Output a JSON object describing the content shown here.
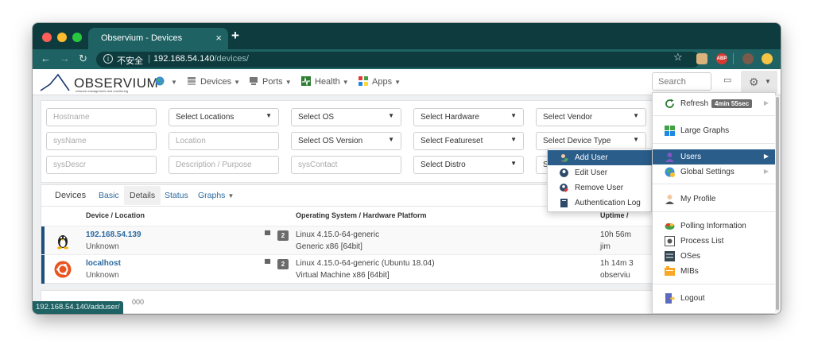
{
  "browser": {
    "tab_title": "Observium - Devices",
    "tab_close": "×",
    "new_tab": "+",
    "insecure_label": "不安全",
    "url_host": "192.168.54.140",
    "url_path": "/devices/",
    "status_url": "192.168.54.140/adduser/"
  },
  "nav": {
    "logo_text": "OBSERVIUM",
    "logo_tagline": "network management and monitoring",
    "items": [
      {
        "label": "Devices"
      },
      {
        "label": "Ports"
      },
      {
        "label": "Health"
      },
      {
        "label": "Apps"
      }
    ],
    "search_placeholder": "Search"
  },
  "filters": {
    "row1": [
      {
        "type": "input",
        "text": "Hostname"
      },
      {
        "type": "select",
        "text": "Select Locations"
      },
      {
        "type": "select",
        "text": "Select OS"
      },
      {
        "type": "select",
        "text": "Select Hardware"
      },
      {
        "type": "select",
        "text": "Select Vendor"
      }
    ],
    "row2": [
      {
        "type": "input",
        "text": "sysName"
      },
      {
        "type": "input",
        "text": "Location"
      },
      {
        "type": "select",
        "text": "Select OS Version"
      },
      {
        "type": "select",
        "text": "Select Featureset"
      },
      {
        "type": "select",
        "text": "Select Device Type"
      }
    ],
    "row3": [
      {
        "type": "input",
        "text": "sysDescr"
      },
      {
        "type": "input",
        "text": "Description / Purpose"
      },
      {
        "type": "input",
        "text": "sysContact"
      },
      {
        "type": "select",
        "text": "Select Distro"
      },
      {
        "type": "select",
        "text": "S"
      }
    ]
  },
  "device_tabs": {
    "title": "Devices",
    "tabs": [
      "Basic",
      "Details",
      "Status",
      "Graphs"
    ]
  },
  "table": {
    "headers": {
      "device": "Device / Location",
      "os": "Operating System / Hardware Platform",
      "uptime": "Uptime /"
    },
    "rows": [
      {
        "name": "192.168.54.139",
        "location": "Unknown",
        "ports": "2",
        "os": "Linux 4.15.0-64-generic",
        "hardware": "Generic x86 [64bit]",
        "uptime": "10h 56m",
        "user": "jim",
        "icon": "linux-tux-icon"
      },
      {
        "name": "localhost",
        "location": "Unknown",
        "ports": "2",
        "os": "Linux 4.15.0-64-generic (Ubuntu 18.04)",
        "hardware": "Virtual Machine x86 [64bit]",
        "uptime": "1h 14m 3",
        "user": "observiu",
        "icon": "ubuntu-icon"
      }
    ]
  },
  "footer_text": "000",
  "gear_menu": {
    "refresh_label": "Refresh",
    "refresh_badge": "4min 55sec",
    "large_graphs": "Large Graphs",
    "users": "Users",
    "global_settings": "Global Settings",
    "my_profile": "My Profile",
    "polling_information": "Polling Information",
    "process_list": "Process List",
    "oses": "OSes",
    "mibs": "MIBs",
    "logout": "Logout"
  },
  "users_submenu": {
    "add_user": "Add User",
    "edit_user": "Edit User",
    "remove_user": "Remove User",
    "auth_log": "Authentication Log"
  },
  "colors": {
    "browser_dark": "#0d3b3e",
    "browser_tab": "#1f6264",
    "link": "#2d6a9f",
    "active_menu": "#2a5d8a",
    "row_bar": "#1d4e7d"
  }
}
